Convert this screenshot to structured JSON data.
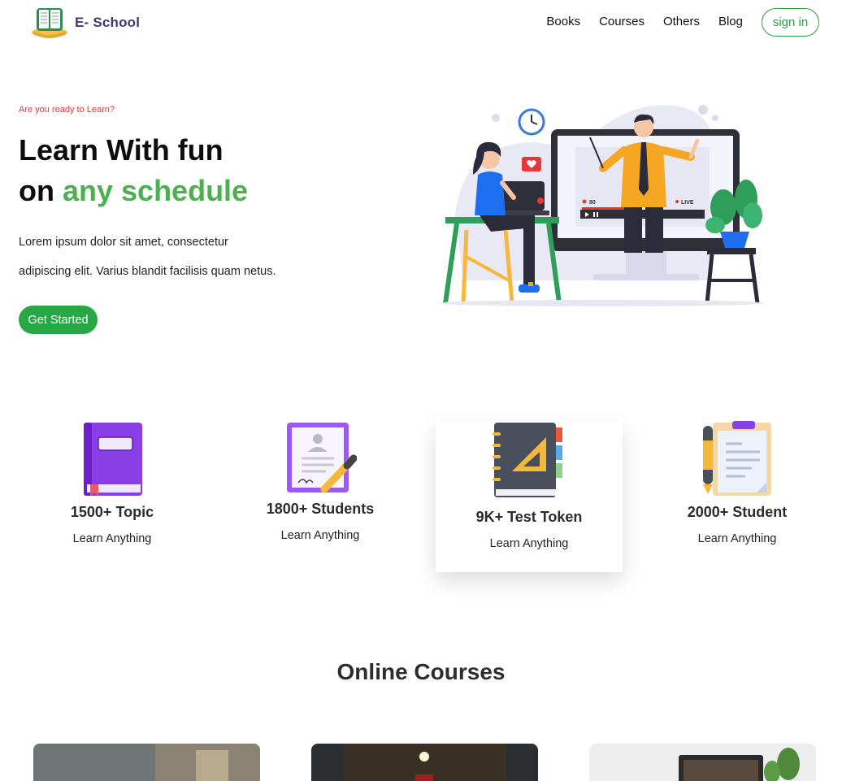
{
  "brand": {
    "name": "E- School"
  },
  "nav": {
    "links": [
      "Books",
      "Courses",
      "Others",
      "Blog"
    ],
    "signin_label": "sign in"
  },
  "hero": {
    "eyebrow": "Are you ready to Learn?",
    "title_line1": "Learn With fun",
    "title_line2_prefix": "on ",
    "title_line2_accent": "any schedule",
    "description_line1": "Lorem ipsum dolor sit amet, consectetur",
    "description_line2": "adipiscing elit. Varius blandit facilisis quam netus.",
    "cta_label": "Get Started",
    "illustration_labels": {
      "viewers": "80",
      "live": "LIVE"
    }
  },
  "stats": [
    {
      "icon": "book-icon",
      "title": "1500+ Topic",
      "subtitle": "Learn Anything"
    },
    {
      "icon": "document-pen-icon",
      "title": "1800+ Students",
      "subtitle": "Learn Anything"
    },
    {
      "icon": "notebook-ruler-icon",
      "title": "9K+ Test Token",
      "subtitle": "Learn Anything"
    },
    {
      "icon": "clipboard-pen-icon",
      "title": "2000+ Student",
      "subtitle": "Learn Anything"
    }
  ],
  "courses": {
    "title": "Online Courses"
  },
  "colors": {
    "accent": "#4caf50",
    "button": "#28a745",
    "eyebrow": "#d93a3a",
    "brand": "#3b3b6d"
  }
}
